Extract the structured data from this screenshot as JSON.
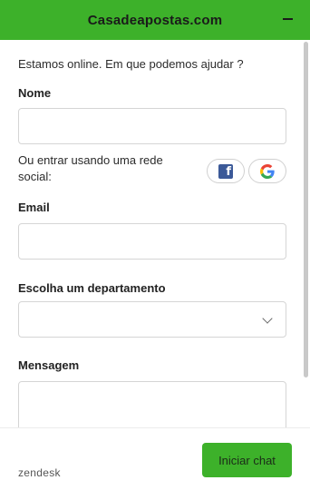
{
  "header": {
    "title": "Casadeapostas.com",
    "minimize_icon": "minus-icon"
  },
  "form": {
    "intro": "Estamos online. Em que podemos ajudar ?",
    "name_label": "Nome",
    "name_value": "",
    "social_text": "Ou entrar usando uma rede social:",
    "social_icons": [
      "facebook-icon",
      "google-icon"
    ],
    "email_label": "Email",
    "email_value": "",
    "department_label": "Escolha um departamento",
    "department_value": "",
    "message_label": "Mensagem",
    "message_value": ""
  },
  "footer": {
    "brand": "zendesk",
    "start_button": "Iniciar chat"
  },
  "colors": {
    "accent": "#3db12a",
    "facebook": "#3b5998"
  }
}
